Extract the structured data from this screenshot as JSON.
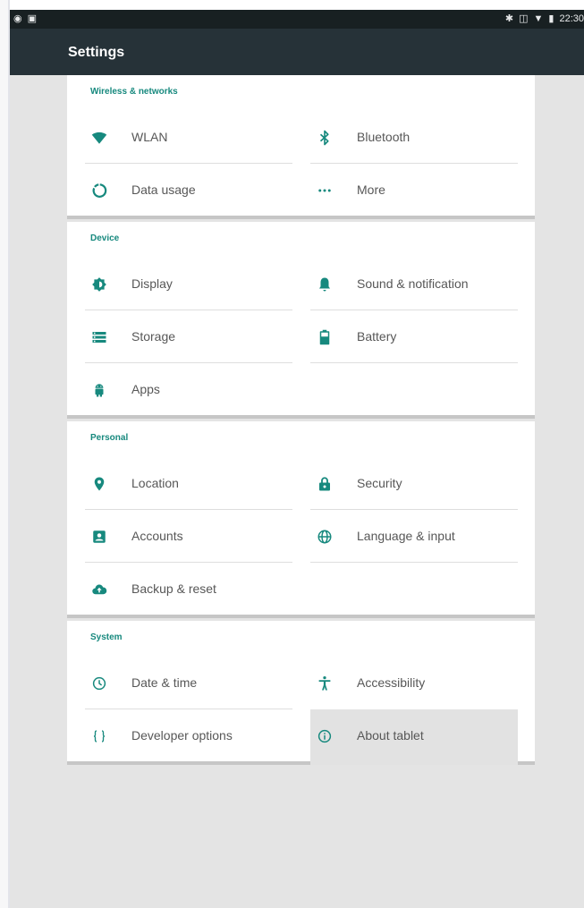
{
  "status_bar": {
    "time": "22:30",
    "left_icons": [
      "globe-notification-icon",
      "image-notification-icon"
    ],
    "right_icons": [
      "bluetooth-icon",
      "vibrate-icon",
      "wifi-icon",
      "battery-icon"
    ]
  },
  "toolbar": {
    "title": "Settings"
  },
  "colors": {
    "accent": "#17897e",
    "toolbar": "#263238",
    "statusbar": "#182022",
    "background": "#e4e4e4",
    "highlight": "#e2e2e2"
  },
  "sections": [
    {
      "title": "Wireless & networks",
      "items": [
        {
          "label": "WLAN",
          "icon": "wifi-icon"
        },
        {
          "label": "Bluetooth",
          "icon": "bluetooth-icon"
        },
        {
          "label": "Data usage",
          "icon": "data-usage-icon"
        },
        {
          "label": "More",
          "icon": "more-icon"
        }
      ]
    },
    {
      "title": "Device",
      "items": [
        {
          "label": "Display",
          "icon": "brightness-icon"
        },
        {
          "label": "Sound & notification",
          "icon": "bell-icon"
        },
        {
          "label": "Storage",
          "icon": "storage-icon"
        },
        {
          "label": "Battery",
          "icon": "battery-icon"
        },
        {
          "label": "Apps",
          "icon": "android-icon"
        }
      ]
    },
    {
      "title": "Personal",
      "items": [
        {
          "label": "Location",
          "icon": "location-pin-icon"
        },
        {
          "label": "Security",
          "icon": "lock-icon"
        },
        {
          "label": "Accounts",
          "icon": "account-box-icon"
        },
        {
          "label": "Language & input",
          "icon": "globe-icon"
        },
        {
          "label": "Backup & reset",
          "icon": "cloud-upload-icon"
        }
      ]
    },
    {
      "title": "System",
      "items": [
        {
          "label": "Date & time",
          "icon": "clock-icon"
        },
        {
          "label": "Accessibility",
          "icon": "accessibility-icon"
        },
        {
          "label": "Developer options",
          "icon": "code-braces-icon"
        },
        {
          "label": "About tablet",
          "icon": "info-icon",
          "selected": true
        }
      ]
    }
  ]
}
